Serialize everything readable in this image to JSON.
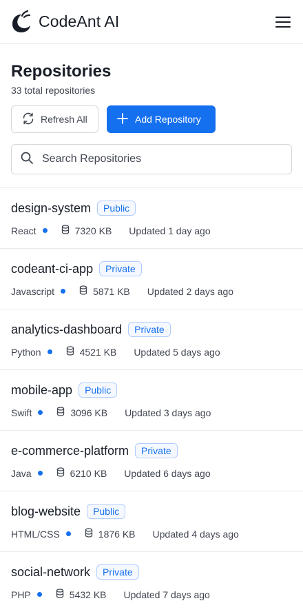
{
  "app": {
    "name": "CodeAnt AI"
  },
  "header": {
    "title": "Repositories",
    "subtitle": "33 total repositories"
  },
  "toolbar": {
    "refresh_label": "Refresh All",
    "add_label": "Add Repository"
  },
  "search": {
    "placeholder": "Search Repositories"
  },
  "colors": {
    "accent": "#1570ef",
    "text": "#181d27",
    "muted": "#414651",
    "border": "#e9eaeb"
  },
  "repositories": [
    {
      "name": "design-system",
      "visibility": "Public",
      "language": "React",
      "size": "7320 KB",
      "updated": "Updated 1 day ago"
    },
    {
      "name": "codeant-ci-app",
      "visibility": "Private",
      "language": "Javascript",
      "size": "5871 KB",
      "updated": "Updated 2 days ago"
    },
    {
      "name": "analytics-dashboard",
      "visibility": "Private",
      "language": "Python",
      "size": "4521 KB",
      "updated": "Updated 5 days ago"
    },
    {
      "name": "mobile-app",
      "visibility": "Public",
      "language": "Swift",
      "size": "3096 KB",
      "updated": "Updated 3 days ago"
    },
    {
      "name": "e-commerce-platform",
      "visibility": "Private",
      "language": "Java",
      "size": "6210 KB",
      "updated": "Updated 6 days ago"
    },
    {
      "name": "blog-website",
      "visibility": "Public",
      "language": "HTML/CSS",
      "size": "1876 KB",
      "updated": "Updated 4 days ago"
    },
    {
      "name": "social-network",
      "visibility": "Private",
      "language": "PHP",
      "size": "5432 KB",
      "updated": "Updated 7 days ago"
    }
  ]
}
